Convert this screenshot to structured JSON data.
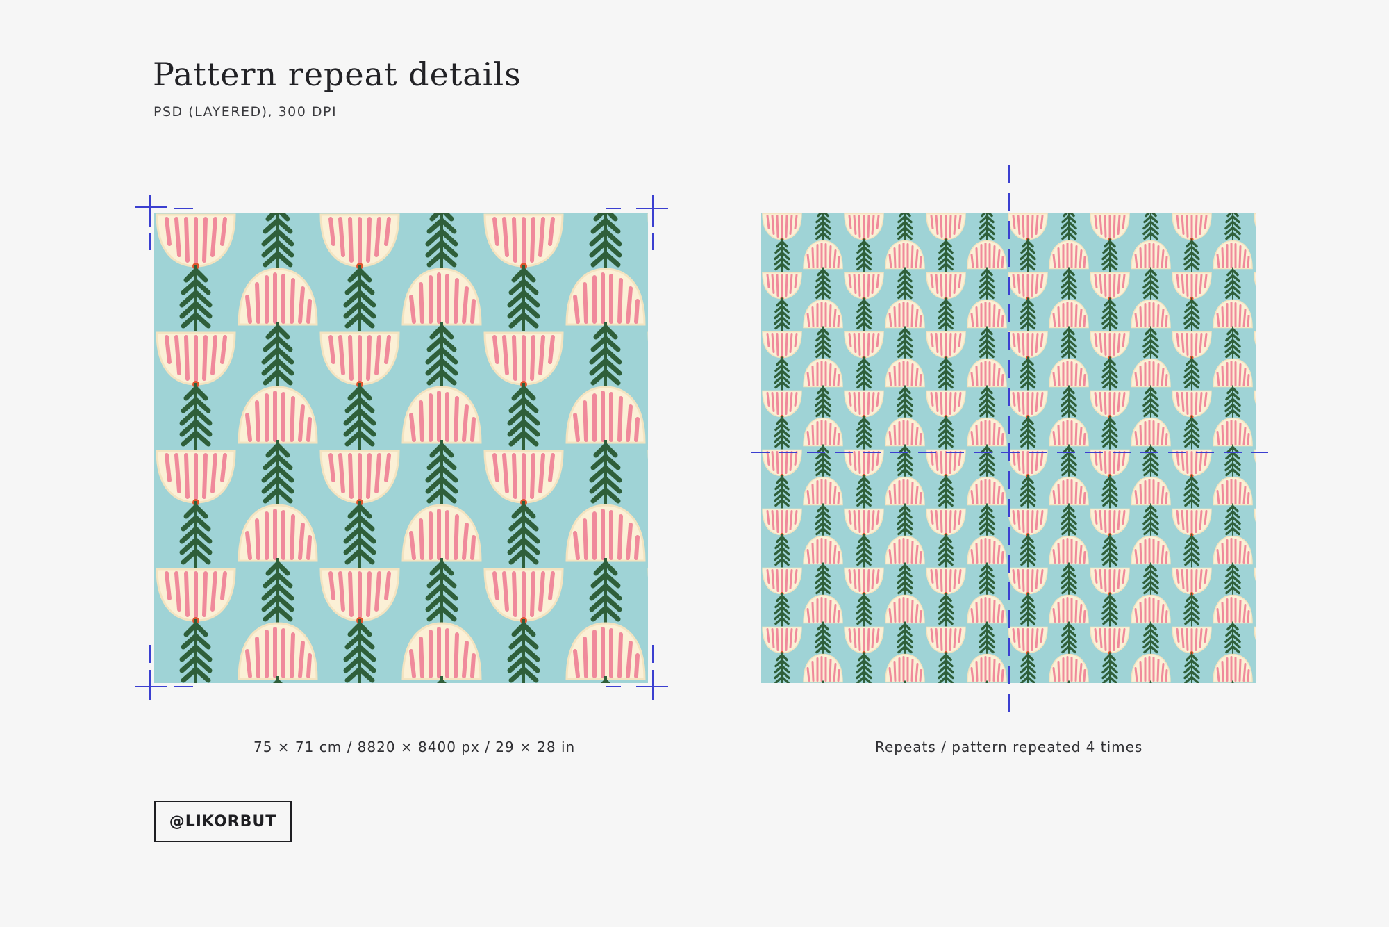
{
  "header": {
    "title": "Pattern repeat details",
    "subtitle": "PSD (LAYERED), 300 DPI"
  },
  "left_panel": {
    "caption": "75 × 71 cm / 8820 × 8400 px / 29 × 28 in"
  },
  "right_panel": {
    "caption": "Repeats / pattern repeated 4 times",
    "repeat_count": 4
  },
  "badge": {
    "label": "@LIKORBUT"
  },
  "colors": {
    "background": "#f6f6f6",
    "pattern_bg": "#9fd3d6",
    "petal_cream": "#fbf0d6",
    "petal_pink": "#f08a9b",
    "leaf_green": "#2f5f3a",
    "guide_blue": "#3b3fd0"
  }
}
